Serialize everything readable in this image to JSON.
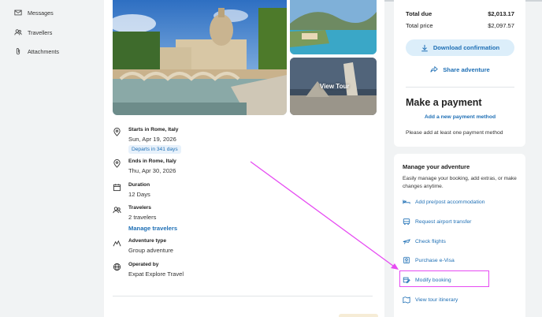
{
  "sidebar": {
    "items": [
      {
        "label": "Messages"
      },
      {
        "label": "Travellers"
      },
      {
        "label": "Attachments"
      }
    ]
  },
  "gallery": {
    "view_tour": "View Tour"
  },
  "details": [
    {
      "label": "Starts in Rome, Italy",
      "value": "Sun, Apr 19, 2026",
      "badge": "Departs in 341 days"
    },
    {
      "label": "Ends in Rome, Italy",
      "value": "Thu, Apr 30, 2026"
    },
    {
      "label": "Duration",
      "value": "12 Days"
    },
    {
      "label": "Travelers",
      "value": "2 travelers",
      "link": "Manage travelers"
    },
    {
      "label": "Adventure type",
      "value": "Group adventure"
    },
    {
      "label": "Operated by",
      "value": "Expat Explore Travel"
    }
  ],
  "summary": {
    "total_due_label": "Total due",
    "total_due": "$2,013.17",
    "total_price_label": "Total price",
    "total_price": "$2,097.57",
    "download": "Download confirmation",
    "share": "Share adventure"
  },
  "payment": {
    "title": "Make a payment",
    "add_method": "Add a new payment method",
    "note": "Please add at least one payment method"
  },
  "manage": {
    "title": "Manage your adventure",
    "description": "Easily manage your booking, add extras, or make changes anytime.",
    "actions": [
      {
        "label": "Add pre/post accommodation",
        "icon": "bed-icon"
      },
      {
        "label": "Request airport transfer",
        "icon": "bus-icon"
      },
      {
        "label": "Check flights",
        "icon": "plane-icon"
      },
      {
        "label": "Purchase e-Visa",
        "icon": "passport-icon"
      },
      {
        "label": "Modify booking",
        "icon": "edit-calendar-icon"
      },
      {
        "label": "View tour itinerary",
        "icon": "map-icon"
      }
    ]
  },
  "annotation": {
    "color": "#e64bf2"
  },
  "colors": {
    "accent": "#1e6fb5",
    "badge_bg": "#e7f1fb",
    "button_bg": "#dceefa"
  }
}
